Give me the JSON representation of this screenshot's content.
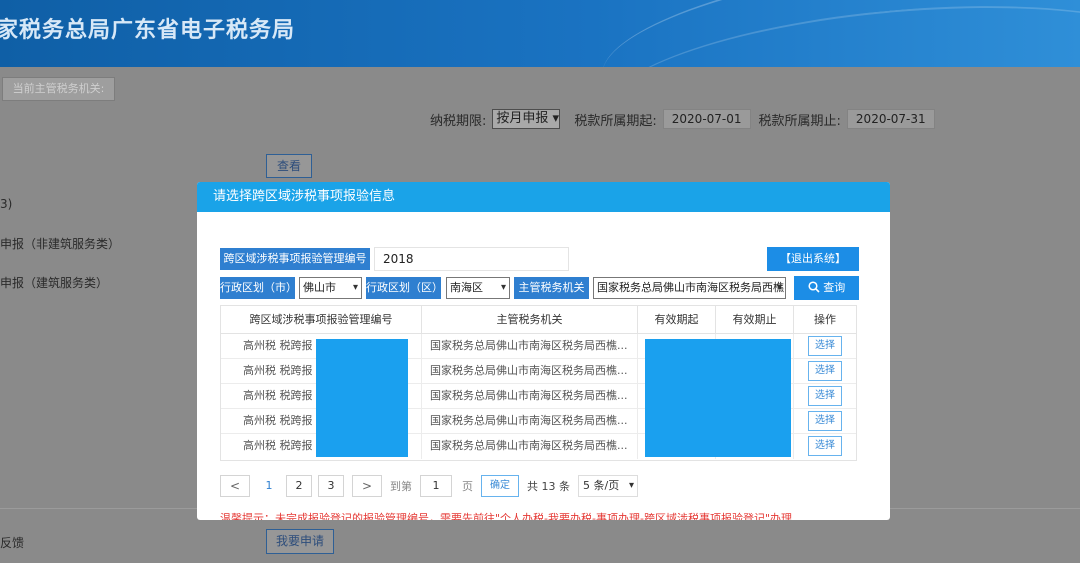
{
  "header": {
    "title": "家税务总局广东省电子税务局"
  },
  "bg": {
    "tax_authority_label": "当前主管税务机关:",
    "period_label": "纳税期限:",
    "period_value": "按月申报",
    "start_label": "税款所属期起:",
    "start_value": "2020-07-01",
    "end_label": "税款所属期止:",
    "end_value": "2020-07-31",
    "view_button": "查看",
    "row1": "3)",
    "row2": "申报（非建筑服务类）",
    "row3": "申报（建筑服务类）",
    "feedback": "反馈",
    "apply_button": "我要申请"
  },
  "modal": {
    "title": "请选择跨区域涉税事项报验信息",
    "code_label": "跨区域涉税事项报验管理编号",
    "code_value": "2018",
    "logout_button": "【退出系统】",
    "city_label": "行政区划（市）",
    "city_value": "佛山市",
    "district_label": "行政区划（区）",
    "district_value": "南海区",
    "authority_label": "主管税务机关",
    "authority_value": "国家税务总局佛山市南海区税务局西樵",
    "query_button": "查询",
    "table": {
      "headers": [
        "跨区域涉税事项报验管理编号",
        "主管税务机关",
        "有效期起",
        "有效期止",
        "操作"
      ],
      "rows": [
        {
          "code": "高州税 税跨报",
          "authority": "国家税务总局佛山市南海区税务局西樵...",
          "action": "选择"
        },
        {
          "code": "高州税 税跨报",
          "authority": "国家税务总局佛山市南海区税务局西樵...",
          "action": "选择"
        },
        {
          "code": "高州税 税跨报",
          "authority": "国家税务总局佛山市南海区税务局西樵...",
          "action": "选择"
        },
        {
          "code": "高州税 税跨报",
          "authority": "国家税务总局佛山市南海区税务局西樵...",
          "action": "选择"
        },
        {
          "code": "高州税 税跨报",
          "authority": "国家税务总局佛山市南海区税务局西樵...",
          "action": "选择"
        }
      ]
    },
    "pager": {
      "prev": "<",
      "pages": [
        "1",
        "2",
        "3"
      ],
      "next": ">",
      "goto": "到第",
      "goto_value": "1",
      "page_unit": "页",
      "ok": "确定",
      "total": "共 13 条",
      "size": "5 条/页"
    },
    "tip": "温馨提示：未完成报验登记的报验管理编号，需要先前往\"个人办税-我要办税-事项办理-跨区域涉税事项报验登记\"办理"
  },
  "colors": {
    "header_blue": "#1a73c2",
    "modal_header": "#1aa3e8",
    "label_blue": "#2f7fd0",
    "button_blue": "#1c8de6",
    "tip_red": "#e53935"
  }
}
